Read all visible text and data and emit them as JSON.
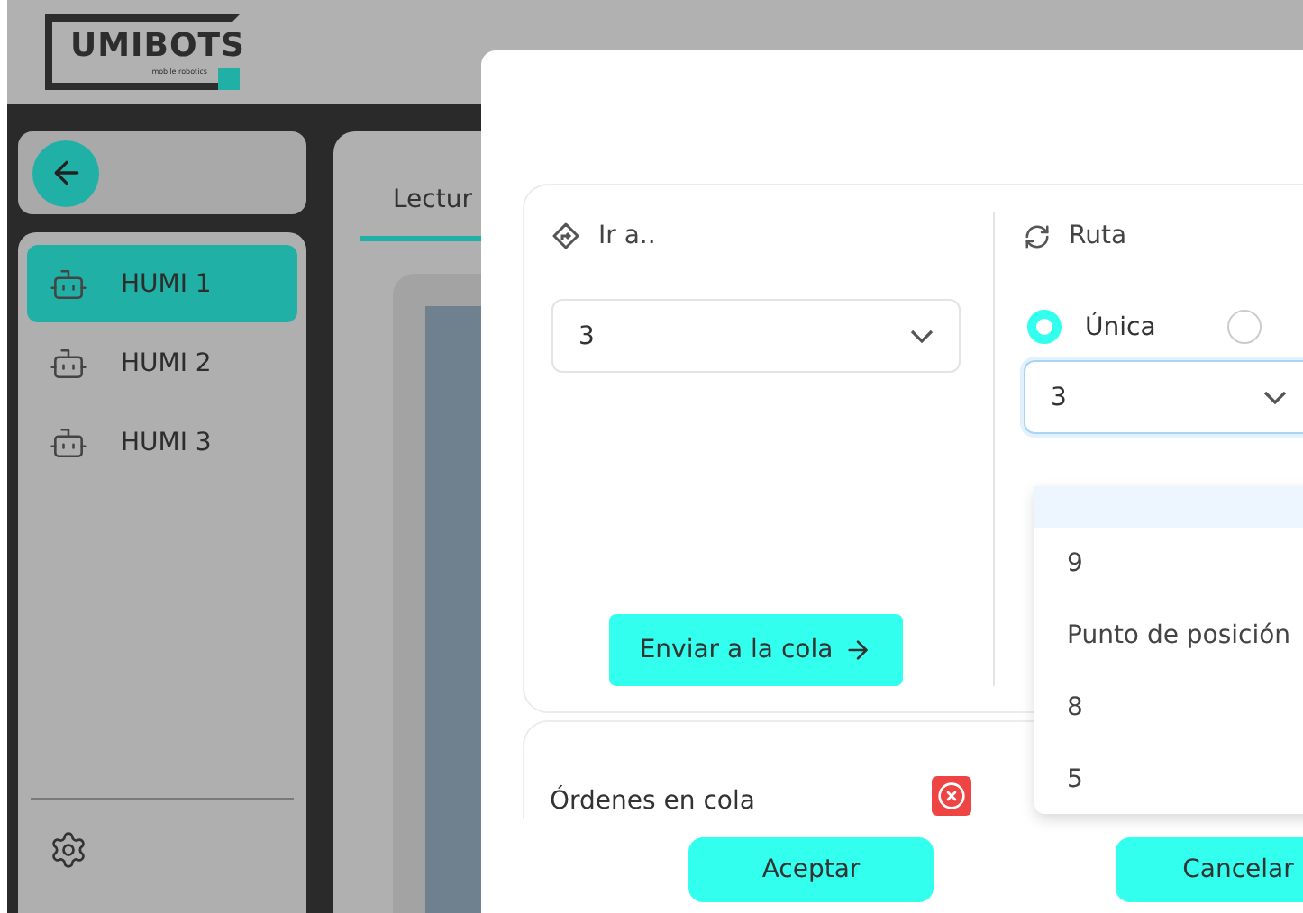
{
  "header": {
    "logo": "UMIBOTS",
    "tagline": "mobile robotics"
  },
  "sidebar": {
    "robots": [
      {
        "name": "HUMI 1",
        "selected": true
      },
      {
        "name": "HUMI 2",
        "selected": false
      },
      {
        "name": "HUMI 3",
        "selected": false
      }
    ]
  },
  "main": {
    "tabs": [
      {
        "label": "Lectur",
        "selected": true
      }
    ]
  },
  "dialog": {
    "go_to": {
      "title": "Ir a..",
      "select": {
        "value": "3"
      },
      "send_button": "Enviar a la cola"
    },
    "route": {
      "title": "Ruta",
      "radios": [
        {
          "label": "Única",
          "selected": true
        },
        {
          "selected": false
        }
      ],
      "select": {
        "value": "3",
        "expanded": true,
        "options": [
          {
            "selected": true
          },
          {
            "label": "9",
            "selected": false
          },
          {
            "label": "Punto de posición",
            "selected": false
          },
          {
            "label": "8",
            "selected": false
          },
          {
            "label": "5",
            "selected": false
          }
        ]
      }
    },
    "queue": {
      "title": "Órdenes en cola"
    },
    "buttons": [
      "Aceptar",
      "Cancelar"
    ]
  }
}
